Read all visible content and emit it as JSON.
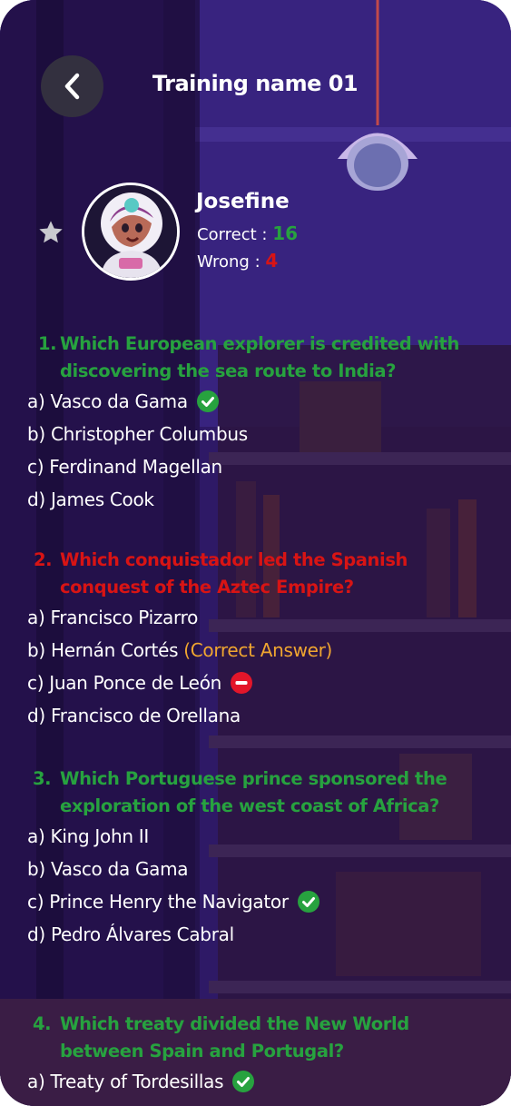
{
  "header": {
    "title": "Training name 01",
    "back_icon": "chevron-left-icon"
  },
  "user": {
    "name": "Josefine",
    "correct_label": "Correct :",
    "correct_value": "16",
    "wrong_label": "Wrong :",
    "wrong_value": "4",
    "star_icon": "star-icon",
    "avatar": "astronaut-avatar"
  },
  "colors": {
    "correct": "#27a23f",
    "wrong": "#d81414",
    "highlight": "#f0a630"
  },
  "questions": [
    {
      "number": "1.",
      "text": "Which European explorer is credited with discovering the sea route to India?",
      "status": "correct",
      "options": [
        "a) Vasco da Gama",
        "b) Christopher Columbus",
        "c) Ferdinand Magellan",
        "d) James Cook"
      ]
    },
    {
      "number": "2.",
      "text": "Which conquistador led the Spanish conquest of the Aztec Empire?",
      "status": "wrong",
      "options": [
        "a) Francisco Pizarro",
        "b) Hernán Cortés",
        "c) Juan Ponce de León",
        "d) Francisco de Orellana"
      ],
      "correct_note": "(Correct Answer)"
    },
    {
      "number": "3.",
      "text": "Which Portuguese prince sponsored the exploration of the west coast of Africa?",
      "status": "correct",
      "options": [
        "a) King John II",
        "b) Vasco da Gama",
        "c) Prince Henry the Navigator",
        "d) Pedro Álvares Cabral"
      ]
    },
    {
      "number": "4.",
      "text": "Which treaty divided the New World between Spain and Portugal?",
      "status": "correct",
      "options": [
        "a) Treaty of Tordesillas"
      ]
    }
  ]
}
